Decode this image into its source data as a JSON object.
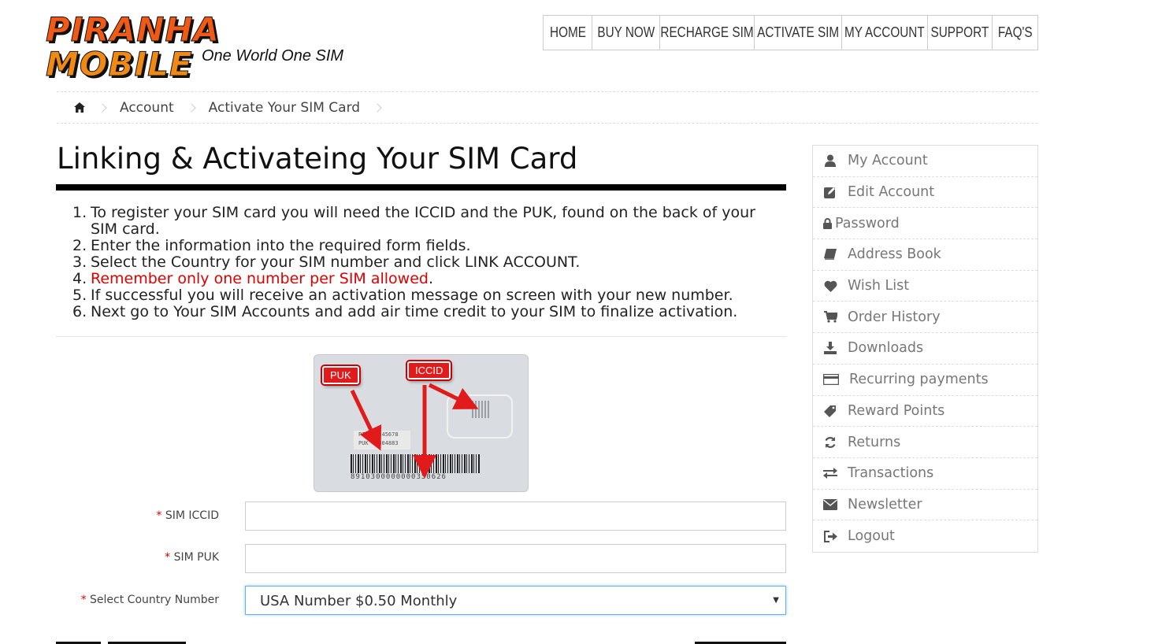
{
  "brand": {
    "logo_word1": "PIRANHA",
    "logo_word2": "MOBILE",
    "tagline": "One World One SIM",
    "colors": {
      "orange": "#f05a14",
      "red_text": "#e00000"
    }
  },
  "topnav": {
    "items": [
      "HOME",
      "BUY NOW",
      "RECHARGE SIM",
      "ACTIVATE SIM",
      "MY ACCOUNT",
      "SUPPORT",
      "FAQ'S"
    ]
  },
  "breadcrumb": {
    "home_icon": "home-icon",
    "items": [
      "Account",
      "Activate Your SIM Card"
    ]
  },
  "main": {
    "title": "Linking & Activateing Your SIM Card",
    "steps": [
      {
        "num": "1.",
        "text": "To register your SIM card you will need the ICCID and the PUK, found on the back of your SIM card."
      },
      {
        "num": "2.",
        "text": "Enter the information into the required form fields."
      },
      {
        "num": "3.",
        "text": "Select the Country for your SIM number and click LINK ACCOUNT."
      },
      {
        "num": "4.",
        "text": "Remember only one number per SIM allowed",
        "suffix": "."
      },
      {
        "num": "5.",
        "text": "If successful you will receive an activation message on screen with your new number."
      },
      {
        "num": "6.",
        "text": "Next go to Your SIM Accounts and add air time credit to your SIM to finalize activation."
      }
    ],
    "sim_image": {
      "puk_tag": "PUK",
      "iccid_tag": "ICCID",
      "pin_line": "PIN  12345678",
      "puk_line": "PUK  47804883",
      "barcode_number": "8910300000000350626"
    }
  },
  "form": {
    "required_mark": "*",
    "iccid_label": "SIM ICCID",
    "iccid_value": "",
    "puk_label": "SIM PUK",
    "puk_value": "",
    "country_label": "Select Country Number",
    "country_selected": "USA Number $0.50 Monthly"
  },
  "sidebar": {
    "items": [
      {
        "label": "My Account",
        "icon": "user-icon"
      },
      {
        "label": "Edit Account",
        "icon": "edit-icon"
      },
      {
        "label": "Password",
        "icon": "lock-icon"
      },
      {
        "label": "Address Book",
        "icon": "book-icon"
      },
      {
        "label": "Wish List",
        "icon": "heart-icon"
      },
      {
        "label": "Order History",
        "icon": "cart-icon"
      },
      {
        "label": "Downloads",
        "icon": "download-icon"
      },
      {
        "label": "Recurring payments",
        "icon": "credit-card-icon"
      },
      {
        "label": "Reward Points",
        "icon": "tag-icon"
      },
      {
        "label": "Returns",
        "icon": "refresh-icon"
      },
      {
        "label": "Transactions",
        "icon": "exchange-icon"
      },
      {
        "label": "Newsletter",
        "icon": "envelope-icon"
      },
      {
        "label": "Logout",
        "icon": "sign-out-icon"
      }
    ]
  }
}
